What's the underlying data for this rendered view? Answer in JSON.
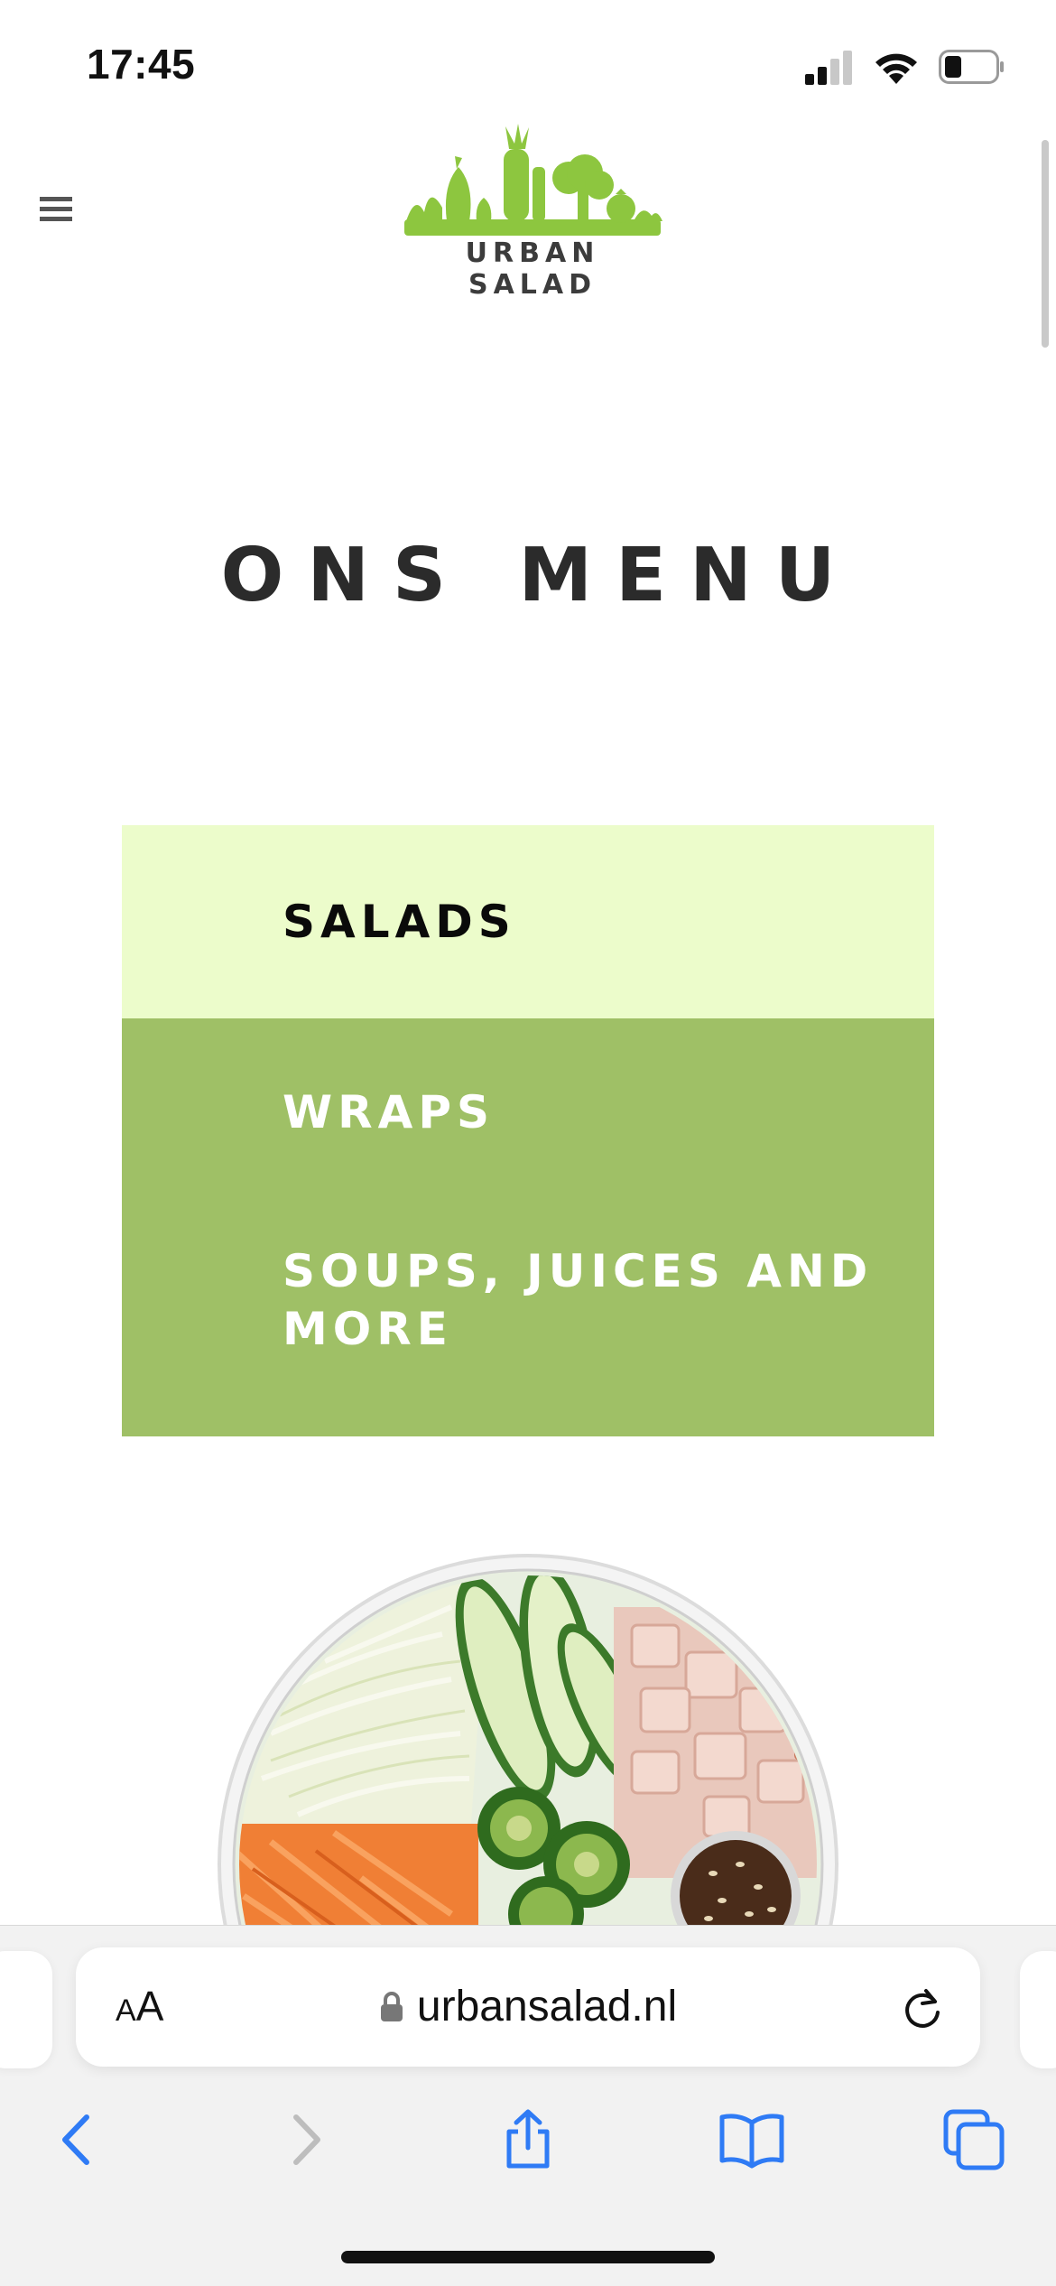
{
  "status": {
    "time": "17:45"
  },
  "header": {
    "logo_text": "URBAN SALAD",
    "brand_color": "#8dc63f"
  },
  "page": {
    "title": "ONS MENU"
  },
  "menu": {
    "items": [
      {
        "label": "SALADS",
        "active": true
      },
      {
        "label": "WRAPS",
        "active": false
      },
      {
        "label": "SOUPS, JUICES AND MORE",
        "active": false
      }
    ],
    "active_bg": "#ecfccb",
    "normal_bg": "#9fc066"
  },
  "browser": {
    "aa_small": "A",
    "aa_big": "A",
    "url": "urbansalad.nl",
    "icons": [
      "lock-icon",
      "reload-icon",
      "back-icon",
      "forward-icon",
      "share-icon",
      "bookmarks-icon",
      "tabs-icon"
    ],
    "accent": "#2f7bf5"
  }
}
